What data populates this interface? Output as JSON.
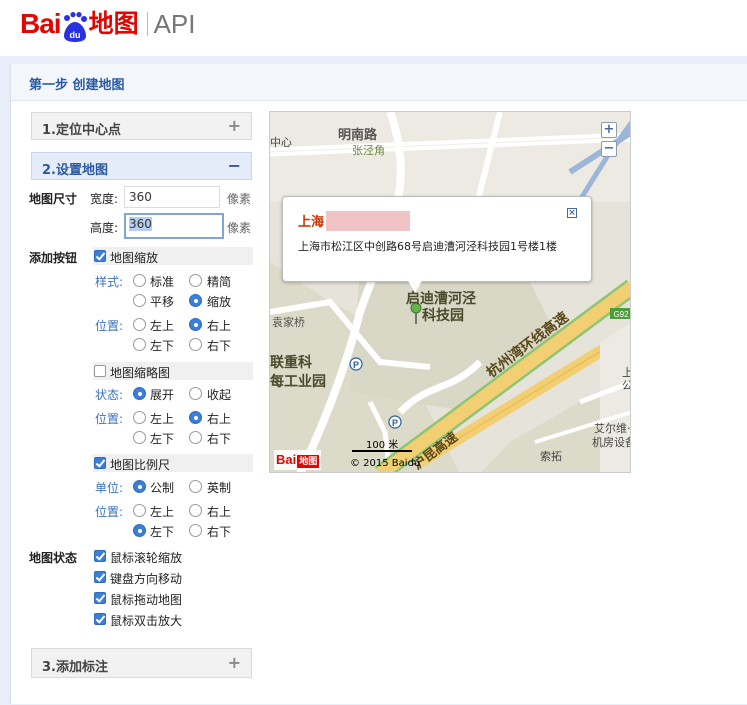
{
  "header": {
    "logo_bai": "Bai",
    "logo_ditu": "地图",
    "logo_api": "API"
  },
  "step": {
    "title": "第一步 创建地图"
  },
  "accordion": [
    {
      "label": "1.定位中心点",
      "sign": "+"
    },
    {
      "label": "2.设置地图",
      "sign": "−"
    },
    {
      "label": "3.添加标注",
      "sign": "+"
    }
  ],
  "size": {
    "label": "地图尺寸",
    "width_label": "宽度:",
    "width_value": "360",
    "height_label": "高度:",
    "height_value": "360",
    "unit": "像素"
  },
  "buttons": {
    "label": "添加按钮",
    "zoom": {
      "label": "地图缩放",
      "checked": true,
      "style_label": "样式:",
      "styles": [
        "标准",
        "精简",
        "平移",
        "缩放"
      ],
      "style_selected": "缩放",
      "pos_label": "位置:",
      "positions": [
        "左上",
        "右上",
        "左下",
        "右下"
      ],
      "pos_selected": "右上"
    },
    "overview": {
      "label": "地图缩略图",
      "checked": false,
      "state_label": "状态:",
      "states": [
        "展开",
        "收起"
      ],
      "state_selected": "展开",
      "pos_label": "位置:",
      "positions": [
        "左上",
        "右上",
        "左下",
        "右下"
      ],
      "pos_selected": "右上"
    },
    "scale": {
      "label": "地图比例尺",
      "checked": true,
      "unit_label": "单位:",
      "units": [
        "公制",
        "英制"
      ],
      "unit_selected": "公制",
      "pos_label": "位置:",
      "positions": [
        "左上",
        "右上",
        "左下",
        "右下"
      ],
      "pos_selected": "左下"
    }
  },
  "map_state": {
    "label": "地图状态",
    "items": [
      "鼠标滚轮缩放",
      "键盘方向移动",
      "鼠标拖动地图",
      "鼠标双击放大"
    ]
  },
  "map": {
    "zoom_in": "+",
    "zoom_out": "−",
    "popup_title": "上海",
    "popup_address": "上海市松江区中创路68号启迪漕河泾科技园1号楼1楼",
    "popup_close": "×",
    "labels": {
      "minnan": "明南路",
      "zhangjing": "张泾角",
      "zhongxin": "中心",
      "qidi1": "启迪漕河泾",
      "qidi2": "科技园",
      "yuanjiaqiao": "袁家桥",
      "lianzhong1": "联重科",
      "lianzhong2": "每工业园",
      "hangzhou": "杭州湾环线高速",
      "hukun": "沪昆高速",
      "suotuo": "索拓",
      "aiershe": "艾尔维·",
      "jifang": "机房设备",
      "g92": "G92",
      "shang": "上",
      "gong": "公"
    },
    "scale_text": "100 米",
    "copyright": "© 2015 Baidu"
  }
}
